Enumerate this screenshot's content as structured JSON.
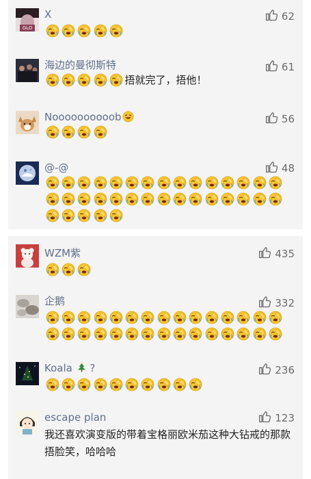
{
  "panels": [
    {
      "comments": [
        {
          "name": "X",
          "likes": "62",
          "emoji_count": 5,
          "text": "",
          "avatar": "dark-figure-avatar"
        },
        {
          "name": "海边的曼彻斯特",
          "likes": "61",
          "emoji_count": 5,
          "text": "捂就完了，捂他！",
          "avatar": "crowd-photo-avatar"
        },
        {
          "name": "Noooooooooob",
          "likes": "56",
          "emoji_count": 4,
          "text": "",
          "avatar": "dog-avatar",
          "name_suffix_icon": "laughing-emoji"
        },
        {
          "name": "@-@",
          "likes": "48",
          "emoji_count": 35,
          "text": "",
          "avatar": "snow-globe-avatar"
        }
      ]
    },
    {
      "comments": [
        {
          "name": "WZM紫",
          "likes": "435",
          "emoji_count": 3,
          "text": "",
          "avatar": "teddy-bear-avatar"
        },
        {
          "name": "企鹅",
          "likes": "332",
          "emoji_count": 30,
          "text": "",
          "avatar": "stones-avatar"
        },
        {
          "name": "Koala",
          "name_extra": "?",
          "likes": "236",
          "emoji_count": 10,
          "text": "",
          "avatar": "night-tree-avatar",
          "name_suffix_icon": "christmas-tree"
        },
        {
          "name": "escape plan",
          "likes": "123",
          "emoji_count": 0,
          "text": "我还喜欢演变版的带着宝格丽欧米茄这种大钻戒的那款捂脸笑，哈哈哈",
          "avatar": "cartoon-girl-avatar"
        }
      ]
    }
  ],
  "icons": {
    "like": "thumbs-up-icon",
    "reaction": "facepalm-emoji"
  },
  "colors": {
    "name": "#5f6f8a",
    "panel_bg": "#f4f4f4",
    "emoji_face": "#f6c531"
  }
}
